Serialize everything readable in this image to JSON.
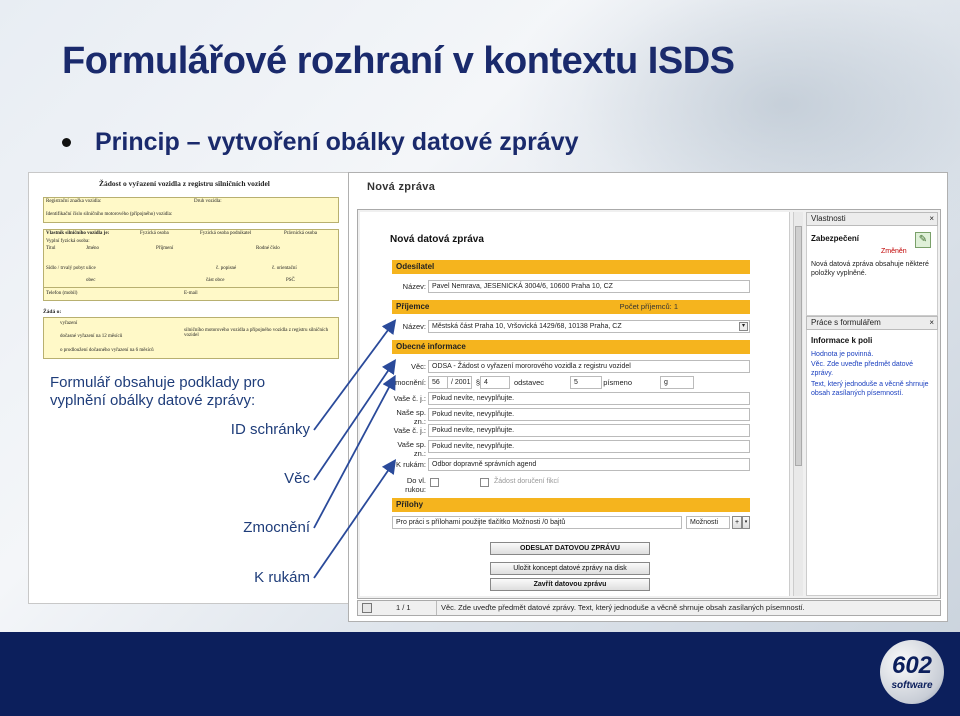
{
  "slide": {
    "title": "Formulářové rozhraní v kontextu ISDS",
    "bullet": "Princip – vytvoření obálky datové zprávy",
    "caption": "Formulář obsahuje podklady pro vyplnění obálky datové zprávy:",
    "labels": [
      "ID schránky",
      "Věc",
      "Zmocnění",
      "K rukám"
    ]
  },
  "paper_form": {
    "title": "Žádost o vyřazení vozidla z registru silničních vozidel",
    "rows": [
      "Registrační značka vozidla:",
      "Druh vozidla:",
      "Identifikační číslo silničního motorového (přípojného) vozidla:",
      "Vlastník silničního vozidla je:",
      "Fyzická osoba",
      "Fyzická osoba podnikatel",
      "Právnická osoba",
      "Vyplní fyzická osoba:",
      "Titul",
      "Jméno",
      "Příjmení",
      "Rodné číslo",
      "Sídlo / trvalý pobyt",
      "ulice",
      "č. popisné",
      "č. orientační",
      "obec",
      "část obce",
      "PSČ",
      "Telefon (mobil)",
      "E-mail",
      "Žádá o:",
      "vyřazení",
      "dočasné vyřazení na 12 měsíců",
      "o prodloužení dočasného vyřazení na 6 měsíců",
      "silničního motorového vozidla a přípojného vozidla z registru silničních vozidel"
    ]
  },
  "app": {
    "window_title": "Nová zpráva",
    "form_title": "Nová datová zpráva",
    "sections": {
      "sender": "Odesílatel",
      "recipients": "Příjemce",
      "recipient_count": "Počet příjemců: 1",
      "general": "Obecné informace",
      "attachments": "Přílohy"
    },
    "fields": {
      "sender_name_label": "Název:",
      "sender_name": "Pavel Nemrava, JESENICKÁ 3004/6, 10600 Praha 10, CZ",
      "recipient_name_label": "Název:",
      "recipient_name": "Městská část Praha 10, Vršovická 1429/68, 10138 Praha, CZ",
      "subject_label": "Věc:",
      "subject": "ODSA - Žádost o vyřazení mororového vozidla z registru vozidel",
      "auth_label": "Zmocnění:",
      "auth_num": "56",
      "auth_year": "/ 2001",
      "auth_sect_sym": "§",
      "auth_sect": "4",
      "auth_para_label": "odstavec",
      "auth_para": "5",
      "auth_letter_label": "písmeno",
      "auth_letter": "g",
      "your_ref_label": "Vaše č. j.:",
      "your_ref": "Pokud nevíte, nevyplňujte.",
      "our_sp_label": "Naše sp. zn.:",
      "our_sp": "Pokud nevíte, nevyplňujte.",
      "your_ref2_label": "Vaše č. j.:",
      "your_ref2": "Pokud nevíte, nevyplňujte.",
      "your_sp_label": "Vaše sp. zn.:",
      "your_sp": "Pokud nevíte, nevyplňujte.",
      "to_hands_label": "K rukám:",
      "to_hands": "Odbor dopravně správních agend",
      "personal_label": "Do vl. rukou:",
      "delivery_note": "Žádost doručení fikcí",
      "attach_text": "Pro práci s přílohami použijte tlačítko Možnosti /0 bajtů",
      "attach_options": "Možnosti"
    },
    "buttons": {
      "send": "ODESLAT DATOVOU ZPRÁVU",
      "save": "Uložit koncept datové zprávy na disk",
      "close": "Zavřít datovou zprávu"
    },
    "properties_panel": {
      "title": "Vlastnosti",
      "security_title": "Zabezpečení",
      "changed": "Změněn",
      "security_text": "Nová datová zpráva obsahuje některé položky vyplněné."
    },
    "fields_panel": {
      "title": "Práce s formulářem",
      "info_title": "Informace k poli",
      "info_lines": [
        "Hodnota je povinná.",
        "Věc. Zde uveďte předmět datové zprávy.",
        "Text, který jednoduše a věcně shrnuje obsah zasílaných písemností."
      ]
    },
    "status": {
      "page": "1 / 1",
      "message": "Věc. Zde uveďte předmět datové zprávy. Text, který jednoduše a věcně shrnuje obsah zasílaných písemností."
    }
  },
  "logo": {
    "number": "602",
    "word": "software"
  },
  "colors": {
    "title": "#1a2a6c",
    "section": "#f5b41e",
    "footer": "#0c1f5c",
    "arrow": "#2a4a9a"
  }
}
